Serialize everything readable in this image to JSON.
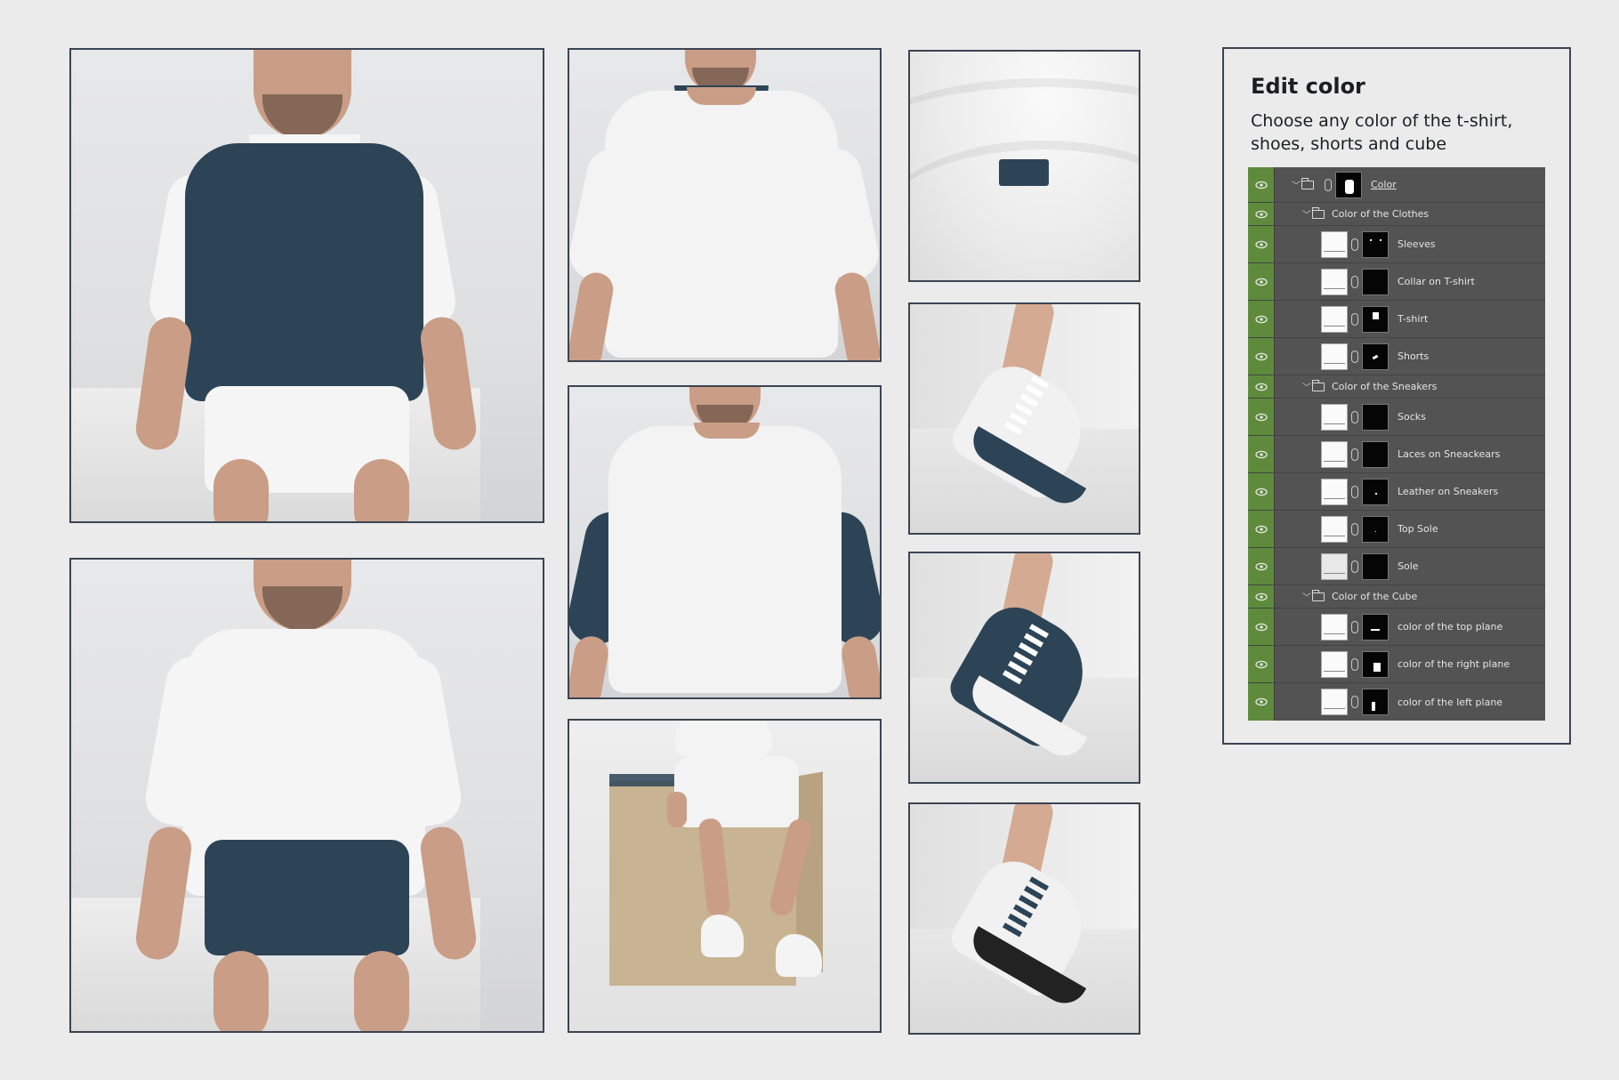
{
  "panel": {
    "title": "Edit color",
    "description": "Choose any color of the t-shirt, shoes, shorts and cube"
  },
  "colors": {
    "navy": "#2d4457",
    "white": "#f5f5f5",
    "layers_bg": "#535353",
    "eye_green": "#5d8a3b",
    "cube_tan": "#c8b392"
  },
  "layers": [
    {
      "type": "root",
      "label": "Color",
      "icon": "folder-icon"
    },
    {
      "type": "group",
      "label": "Color of the Clothes",
      "icon": "folder-icon"
    },
    {
      "type": "layer",
      "label": "Sleeves"
    },
    {
      "type": "layer",
      "label": "Collar on T-shirt"
    },
    {
      "type": "layer",
      "label": "T-shirt"
    },
    {
      "type": "layer",
      "label": "Shorts"
    },
    {
      "type": "group",
      "label": "Color of the Sneakers",
      "icon": "folder-icon"
    },
    {
      "type": "layer",
      "label": "Socks"
    },
    {
      "type": "layer",
      "label": "Laces on Sneackears"
    },
    {
      "type": "layer",
      "label": "Leather on Sneakers"
    },
    {
      "type": "layer",
      "label": "Top Sole"
    },
    {
      "type": "layer",
      "label": "Sole"
    },
    {
      "type": "group",
      "label": "Color of the Cube",
      "icon": "folder-icon"
    },
    {
      "type": "layer",
      "label": "color of the top plane"
    },
    {
      "type": "layer",
      "label": "color of the right plane"
    },
    {
      "type": "layer",
      "label": "color of the left plane"
    }
  ]
}
